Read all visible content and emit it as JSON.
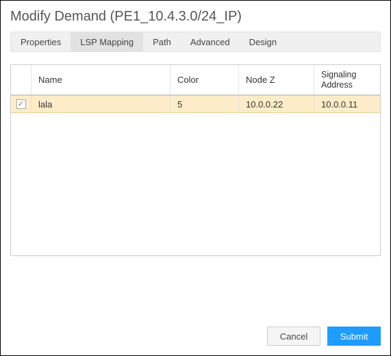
{
  "title": "Modify Demand (PE1_10.4.3.0/24_IP)",
  "tabs": {
    "properties": "Properties",
    "lsp_mapping": "LSP Mapping",
    "path": "Path",
    "advanced": "Advanced",
    "design": "Design",
    "active": "lsp_mapping"
  },
  "table": {
    "headers": {
      "name": "Name",
      "color": "Color",
      "nodez": "Node Z",
      "sig": "Signaling Address"
    },
    "rows": [
      {
        "checked": true,
        "name": "lala",
        "color": "5",
        "nodez": "10.0.0.22",
        "sig": "10.0.0.11"
      }
    ]
  },
  "buttons": {
    "cancel": "Cancel",
    "submit": "Submit"
  }
}
